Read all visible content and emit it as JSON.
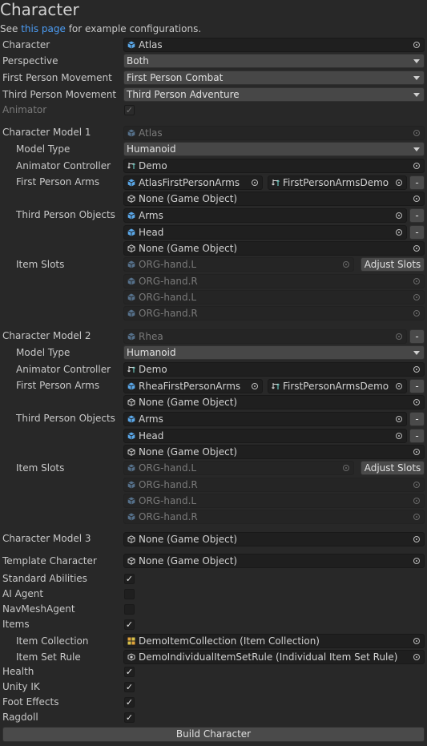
{
  "header": {
    "title": "Character",
    "intro_prefix": "See ",
    "intro_link": "this page",
    "intro_suffix": " for example configurations."
  },
  "rows": {
    "character": {
      "label": "Character",
      "value": "Atlas"
    },
    "perspective": {
      "label": "Perspective",
      "value": "Both"
    },
    "fp_movement": {
      "label": "First Person Movement",
      "value": "First Person Combat"
    },
    "tp_movement": {
      "label": "Third Person Movement",
      "value": "Third Person Adventure"
    },
    "animator": {
      "label": "Animator",
      "checked": "✓"
    }
  },
  "model1": {
    "label": "Character Model 1",
    "value": "Atlas",
    "model_type_label": "Model Type",
    "model_type": "Humanoid",
    "animator_controller_label": "Animator Controller",
    "animator_controller": "Demo",
    "fp_arms_label": "First Person Arms",
    "fp_arms_1": "AtlasFirstPersonArms",
    "fp_arms_2": "FirstPersonArmsDemo",
    "fp_arms_none": "None (Game Object)",
    "tp_objects_label": "Third Person Objects",
    "tp_obj_1": "Arms",
    "tp_obj_2": "Head",
    "tp_obj_none": "None (Game Object)",
    "item_slots_label": "Item Slots",
    "slots": [
      "ORG-hand.L",
      "ORG-hand.R",
      "ORG-hand.L",
      "ORG-hand.R"
    ],
    "adjust_slots": "Adjust Slots"
  },
  "model2": {
    "label": "Character Model 2",
    "value": "Rhea",
    "model_type_label": "Model Type",
    "model_type": "Humanoid",
    "animator_controller_label": "Animator Controller",
    "animator_controller": "Demo",
    "fp_arms_label": "First Person Arms",
    "fp_arms_1": "RheaFirstPersonArms",
    "fp_arms_2": "FirstPersonArmsDemo",
    "fp_arms_none": "None (Game Object)",
    "tp_objects_label": "Third Person Objects",
    "tp_obj_1": "Arms",
    "tp_obj_2": "Head",
    "tp_obj_none": "None (Game Object)",
    "item_slots_label": "Item Slots",
    "slots": [
      "ORG-hand.L",
      "ORG-hand.R",
      "ORG-hand.L",
      "ORG-hand.R"
    ],
    "adjust_slots": "Adjust Slots"
  },
  "model3": {
    "label": "Character Model 3",
    "value": "None (Game Object)"
  },
  "template": {
    "label": "Template Character",
    "value": "None (Game Object)"
  },
  "toggles": {
    "standard_abilities": {
      "label": "Standard Abilities",
      "checked": "✓"
    },
    "ai_agent": {
      "label": "AI Agent",
      "checked": ""
    },
    "navmesh_agent": {
      "label": "NavMeshAgent",
      "checked": ""
    },
    "items": {
      "label": "Items",
      "checked": "✓"
    },
    "health": {
      "label": "Health",
      "checked": "✓"
    },
    "unity_ik": {
      "label": "Unity IK",
      "checked": "✓"
    },
    "foot_effects": {
      "label": "Foot Effects",
      "checked": "✓"
    },
    "ragdoll": {
      "label": "Ragdoll",
      "checked": "✓"
    }
  },
  "items_section": {
    "item_collection_label": "Item Collection",
    "item_collection": "DemoItemCollection (Item Collection)",
    "item_set_rule_label": "Item Set Rule",
    "item_set_rule": "DemoIndividualItemSetRule (Individual Item Set Rule)"
  },
  "minus": "-",
  "build_button": "Build Character",
  "icons": {
    "prefab": "prefab-cube-icon",
    "controller": "animator-controller-icon",
    "gameobject": "gameobject-icon",
    "picker": "object-picker-icon",
    "collection": "item-collection-icon",
    "rule": "item-set-rule-icon"
  },
  "colors": {
    "link": "#4c9df5",
    "prefab_icon": "#5aa7e8",
    "background": "#282828"
  }
}
